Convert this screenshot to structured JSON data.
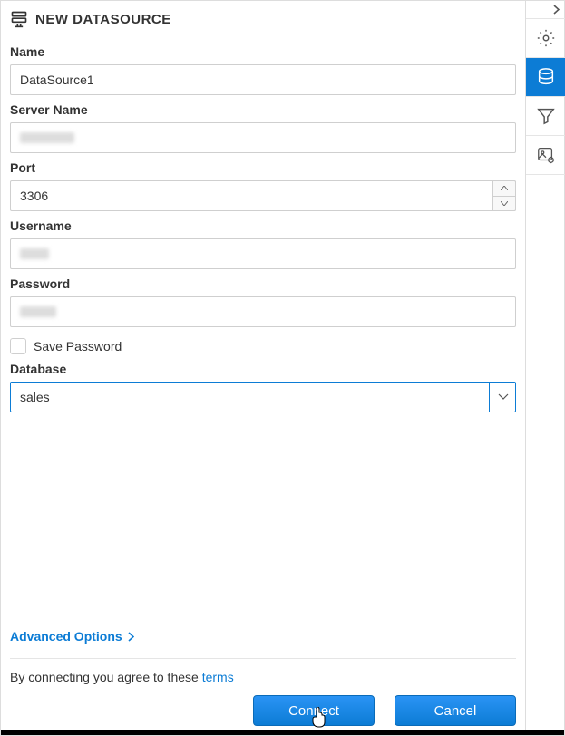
{
  "header": {
    "title": "NEW DATASOURCE"
  },
  "form": {
    "name": {
      "label": "Name",
      "value": "DataSource1"
    },
    "serverName": {
      "label": "Server Name",
      "value": ""
    },
    "port": {
      "label": "Port",
      "value": "3306"
    },
    "username": {
      "label": "Username",
      "value": ""
    },
    "password": {
      "label": "Password",
      "value": ""
    },
    "savePassword": {
      "label": "Save Password",
      "checked": false
    },
    "database": {
      "label": "Database",
      "value": "sales"
    }
  },
  "advancedOptions": {
    "label": "Advanced Options"
  },
  "terms": {
    "text": "By connecting you agree to these ",
    "linkText": "terms"
  },
  "buttons": {
    "connect": "Connect",
    "cancel": "Cancel"
  },
  "sidebar": {
    "items": [
      {
        "name": "collapse-panel",
        "icon": "chevron-right"
      },
      {
        "name": "settings",
        "icon": "gear"
      },
      {
        "name": "datasources",
        "icon": "database",
        "active": true
      },
      {
        "name": "filter",
        "icon": "funnel"
      },
      {
        "name": "image-settings",
        "icon": "image-gear"
      }
    ]
  }
}
